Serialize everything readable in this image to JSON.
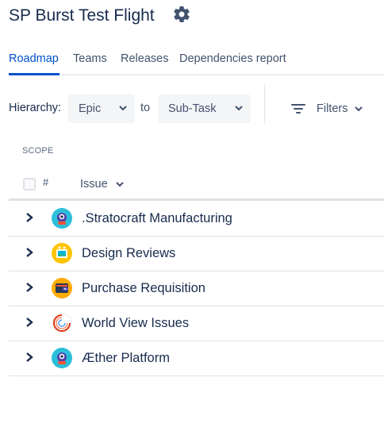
{
  "header": {
    "title": "SP Burst Test Flight",
    "settings_icon": "gear-icon"
  },
  "tabs": [
    {
      "label": "Roadmap",
      "active": true
    },
    {
      "label": "Teams",
      "active": false
    },
    {
      "label": "Releases",
      "active": false
    },
    {
      "label": "Dependencies report",
      "active": false
    }
  ],
  "toolbar": {
    "hierarchy_label": "Hierarchy:",
    "from_value": "Epic",
    "to_label": "to",
    "to_value": "Sub-Task",
    "filters_label": "Filters"
  },
  "table": {
    "scope_label": "SCOPE",
    "hash_header": "#",
    "issue_header": "Issue",
    "rows": [
      {
        "label": ".Stratocraft Manufacturing",
        "icon": "robot-avatar-icon"
      },
      {
        "label": "Design Reviews",
        "icon": "picture-frame-avatar-icon"
      },
      {
        "label": "Purchase Requisition",
        "icon": "wallet-avatar-icon"
      },
      {
        "label": "World View Issues",
        "icon": "swirl-avatar-icon"
      },
      {
        "label": "Æther Platform",
        "icon": "robot-avatar-icon"
      }
    ]
  },
  "colors": {
    "accent": "#0052cc",
    "text": "#172b4d",
    "muted": "#42526e",
    "border": "#dfe1e6"
  }
}
